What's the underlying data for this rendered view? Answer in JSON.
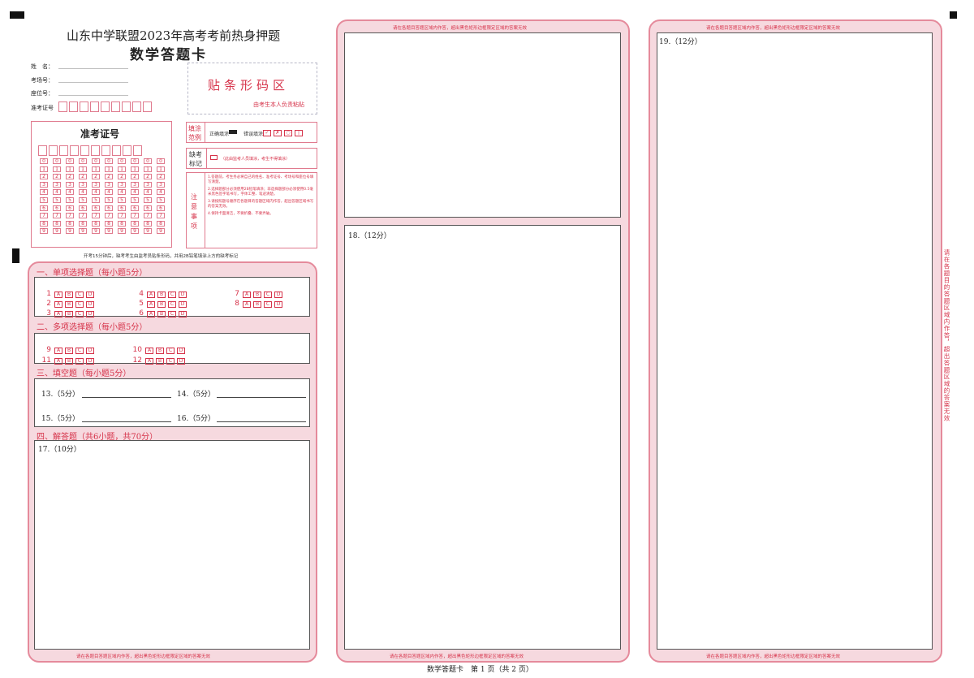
{
  "header": {
    "exam_title": "山东中学联盟2023年高考考前热身押题",
    "card_title": "数学答题卡"
  },
  "student_info": {
    "name_label": "姓　名：",
    "room_label": "考场号：",
    "seat_label": "座位号：",
    "id_label": "准考证号"
  },
  "barcode": {
    "title": "贴条形码区",
    "note": "由考生本人负责粘贴"
  },
  "admission_grid": {
    "title": "准考证号",
    "digits": [
      "0",
      "1",
      "2",
      "3",
      "4",
      "5",
      "6",
      "7",
      "8",
      "9"
    ]
  },
  "fill_example": {
    "label": "填涂范例",
    "correct": "正确填涂",
    "wrong": "错误填涂"
  },
  "absent": {
    "label": "缺考标记",
    "note": "（此由监考人员填涂，考生不得填涂）"
  },
  "notice": {
    "label": "注意事项",
    "items": [
      "1.答题前，考生务必将自己的姓名、准考证号、考场号和座位号填写清楚。",
      "2.选择题部分必须使用2B铅笔填涂；非选择题部分必须使用0.5毫米黑色签字笔书写，字体工整、笔迹清楚。",
      "3.请按照题号顺序在各题目的答题区域内作答，超出答题区域书写的答案无效。",
      "4.保持卡面清洁，不要折叠、不要弄破。"
    ]
  },
  "exam_note": "开考15分钟后，缺考考生由监考员贴条形码，并用2B铅笔填涂上方的缺考标记",
  "sections": {
    "single_choice": {
      "title": "一、单项选择题（每小题5分）",
      "questions": [
        "1",
        "2",
        "3",
        "4",
        "5",
        "6",
        "7",
        "8"
      ],
      "options": [
        "A",
        "B",
        "C",
        "D"
      ]
    },
    "multi_choice": {
      "title": "二、多项选择题（每小题5分）",
      "questions": [
        "9",
        "10",
        "11",
        "12"
      ],
      "options": [
        "A",
        "B",
        "C",
        "D"
      ]
    },
    "fill_blank": {
      "title": "三、填空题（每小题5分）",
      "items": [
        "13.（5分）",
        "14.（5分）",
        "15.（5分）",
        "16.（5分）"
      ]
    },
    "solution": {
      "title": "四、解答题（共6小题，共70分）",
      "q17": "17.（10分）"
    }
  },
  "col2": {
    "q18": "18.（12分）"
  },
  "col3": {
    "q19": "19.（12分）"
  },
  "warnings": {
    "boundary": "请在各题目答题区域内作答，超出黑色矩形边框限定区域的答案无效",
    "side_vertical": "请在各题目的答题区域内作答，超出答题区域的答案无效"
  },
  "footer": {
    "page": "数学答题卡　第 1 页（共 2 页）"
  }
}
